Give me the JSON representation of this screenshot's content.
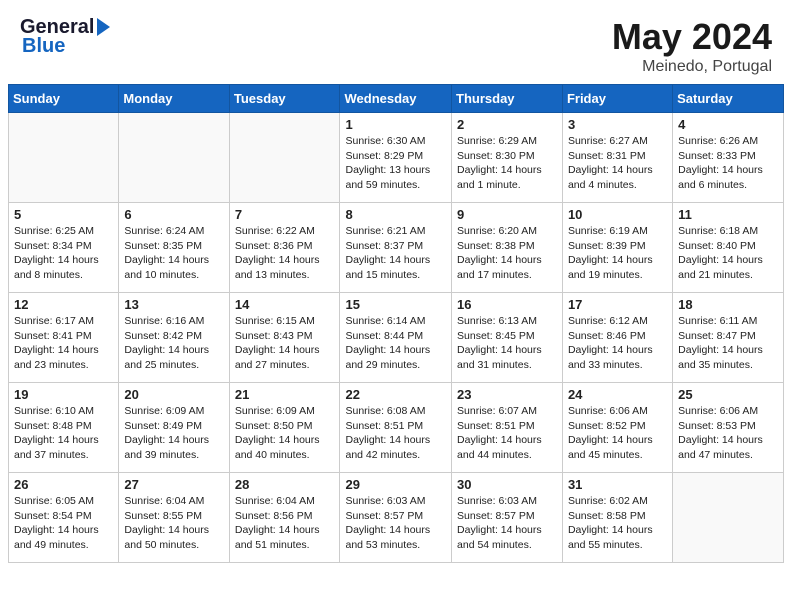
{
  "header": {
    "logo_general": "General",
    "logo_blue": "Blue",
    "month_title": "May 2024",
    "location": "Meinedo, Portugal"
  },
  "weekdays": [
    "Sunday",
    "Monday",
    "Tuesday",
    "Wednesday",
    "Thursday",
    "Friday",
    "Saturday"
  ],
  "weeks": [
    [
      {
        "day": "",
        "info": ""
      },
      {
        "day": "",
        "info": ""
      },
      {
        "day": "",
        "info": ""
      },
      {
        "day": "1",
        "info": "Sunrise: 6:30 AM\nSunset: 8:29 PM\nDaylight: 13 hours\nand 59 minutes."
      },
      {
        "day": "2",
        "info": "Sunrise: 6:29 AM\nSunset: 8:30 PM\nDaylight: 14 hours\nand 1 minute."
      },
      {
        "day": "3",
        "info": "Sunrise: 6:27 AM\nSunset: 8:31 PM\nDaylight: 14 hours\nand 4 minutes."
      },
      {
        "day": "4",
        "info": "Sunrise: 6:26 AM\nSunset: 8:33 PM\nDaylight: 14 hours\nand 6 minutes."
      }
    ],
    [
      {
        "day": "5",
        "info": "Sunrise: 6:25 AM\nSunset: 8:34 PM\nDaylight: 14 hours\nand 8 minutes."
      },
      {
        "day": "6",
        "info": "Sunrise: 6:24 AM\nSunset: 8:35 PM\nDaylight: 14 hours\nand 10 minutes."
      },
      {
        "day": "7",
        "info": "Sunrise: 6:22 AM\nSunset: 8:36 PM\nDaylight: 14 hours\nand 13 minutes."
      },
      {
        "day": "8",
        "info": "Sunrise: 6:21 AM\nSunset: 8:37 PM\nDaylight: 14 hours\nand 15 minutes."
      },
      {
        "day": "9",
        "info": "Sunrise: 6:20 AM\nSunset: 8:38 PM\nDaylight: 14 hours\nand 17 minutes."
      },
      {
        "day": "10",
        "info": "Sunrise: 6:19 AM\nSunset: 8:39 PM\nDaylight: 14 hours\nand 19 minutes."
      },
      {
        "day": "11",
        "info": "Sunrise: 6:18 AM\nSunset: 8:40 PM\nDaylight: 14 hours\nand 21 minutes."
      }
    ],
    [
      {
        "day": "12",
        "info": "Sunrise: 6:17 AM\nSunset: 8:41 PM\nDaylight: 14 hours\nand 23 minutes."
      },
      {
        "day": "13",
        "info": "Sunrise: 6:16 AM\nSunset: 8:42 PM\nDaylight: 14 hours\nand 25 minutes."
      },
      {
        "day": "14",
        "info": "Sunrise: 6:15 AM\nSunset: 8:43 PM\nDaylight: 14 hours\nand 27 minutes."
      },
      {
        "day": "15",
        "info": "Sunrise: 6:14 AM\nSunset: 8:44 PM\nDaylight: 14 hours\nand 29 minutes."
      },
      {
        "day": "16",
        "info": "Sunrise: 6:13 AM\nSunset: 8:45 PM\nDaylight: 14 hours\nand 31 minutes."
      },
      {
        "day": "17",
        "info": "Sunrise: 6:12 AM\nSunset: 8:46 PM\nDaylight: 14 hours\nand 33 minutes."
      },
      {
        "day": "18",
        "info": "Sunrise: 6:11 AM\nSunset: 8:47 PM\nDaylight: 14 hours\nand 35 minutes."
      }
    ],
    [
      {
        "day": "19",
        "info": "Sunrise: 6:10 AM\nSunset: 8:48 PM\nDaylight: 14 hours\nand 37 minutes."
      },
      {
        "day": "20",
        "info": "Sunrise: 6:09 AM\nSunset: 8:49 PM\nDaylight: 14 hours\nand 39 minutes."
      },
      {
        "day": "21",
        "info": "Sunrise: 6:09 AM\nSunset: 8:50 PM\nDaylight: 14 hours\nand 40 minutes."
      },
      {
        "day": "22",
        "info": "Sunrise: 6:08 AM\nSunset: 8:51 PM\nDaylight: 14 hours\nand 42 minutes."
      },
      {
        "day": "23",
        "info": "Sunrise: 6:07 AM\nSunset: 8:51 PM\nDaylight: 14 hours\nand 44 minutes."
      },
      {
        "day": "24",
        "info": "Sunrise: 6:06 AM\nSunset: 8:52 PM\nDaylight: 14 hours\nand 45 minutes."
      },
      {
        "day": "25",
        "info": "Sunrise: 6:06 AM\nSunset: 8:53 PM\nDaylight: 14 hours\nand 47 minutes."
      }
    ],
    [
      {
        "day": "26",
        "info": "Sunrise: 6:05 AM\nSunset: 8:54 PM\nDaylight: 14 hours\nand 49 minutes."
      },
      {
        "day": "27",
        "info": "Sunrise: 6:04 AM\nSunset: 8:55 PM\nDaylight: 14 hours\nand 50 minutes."
      },
      {
        "day": "28",
        "info": "Sunrise: 6:04 AM\nSunset: 8:56 PM\nDaylight: 14 hours\nand 51 minutes."
      },
      {
        "day": "29",
        "info": "Sunrise: 6:03 AM\nSunset: 8:57 PM\nDaylight: 14 hours\nand 53 minutes."
      },
      {
        "day": "30",
        "info": "Sunrise: 6:03 AM\nSunset: 8:57 PM\nDaylight: 14 hours\nand 54 minutes."
      },
      {
        "day": "31",
        "info": "Sunrise: 6:02 AM\nSunset: 8:58 PM\nDaylight: 14 hours\nand 55 minutes."
      },
      {
        "day": "",
        "info": ""
      }
    ]
  ]
}
